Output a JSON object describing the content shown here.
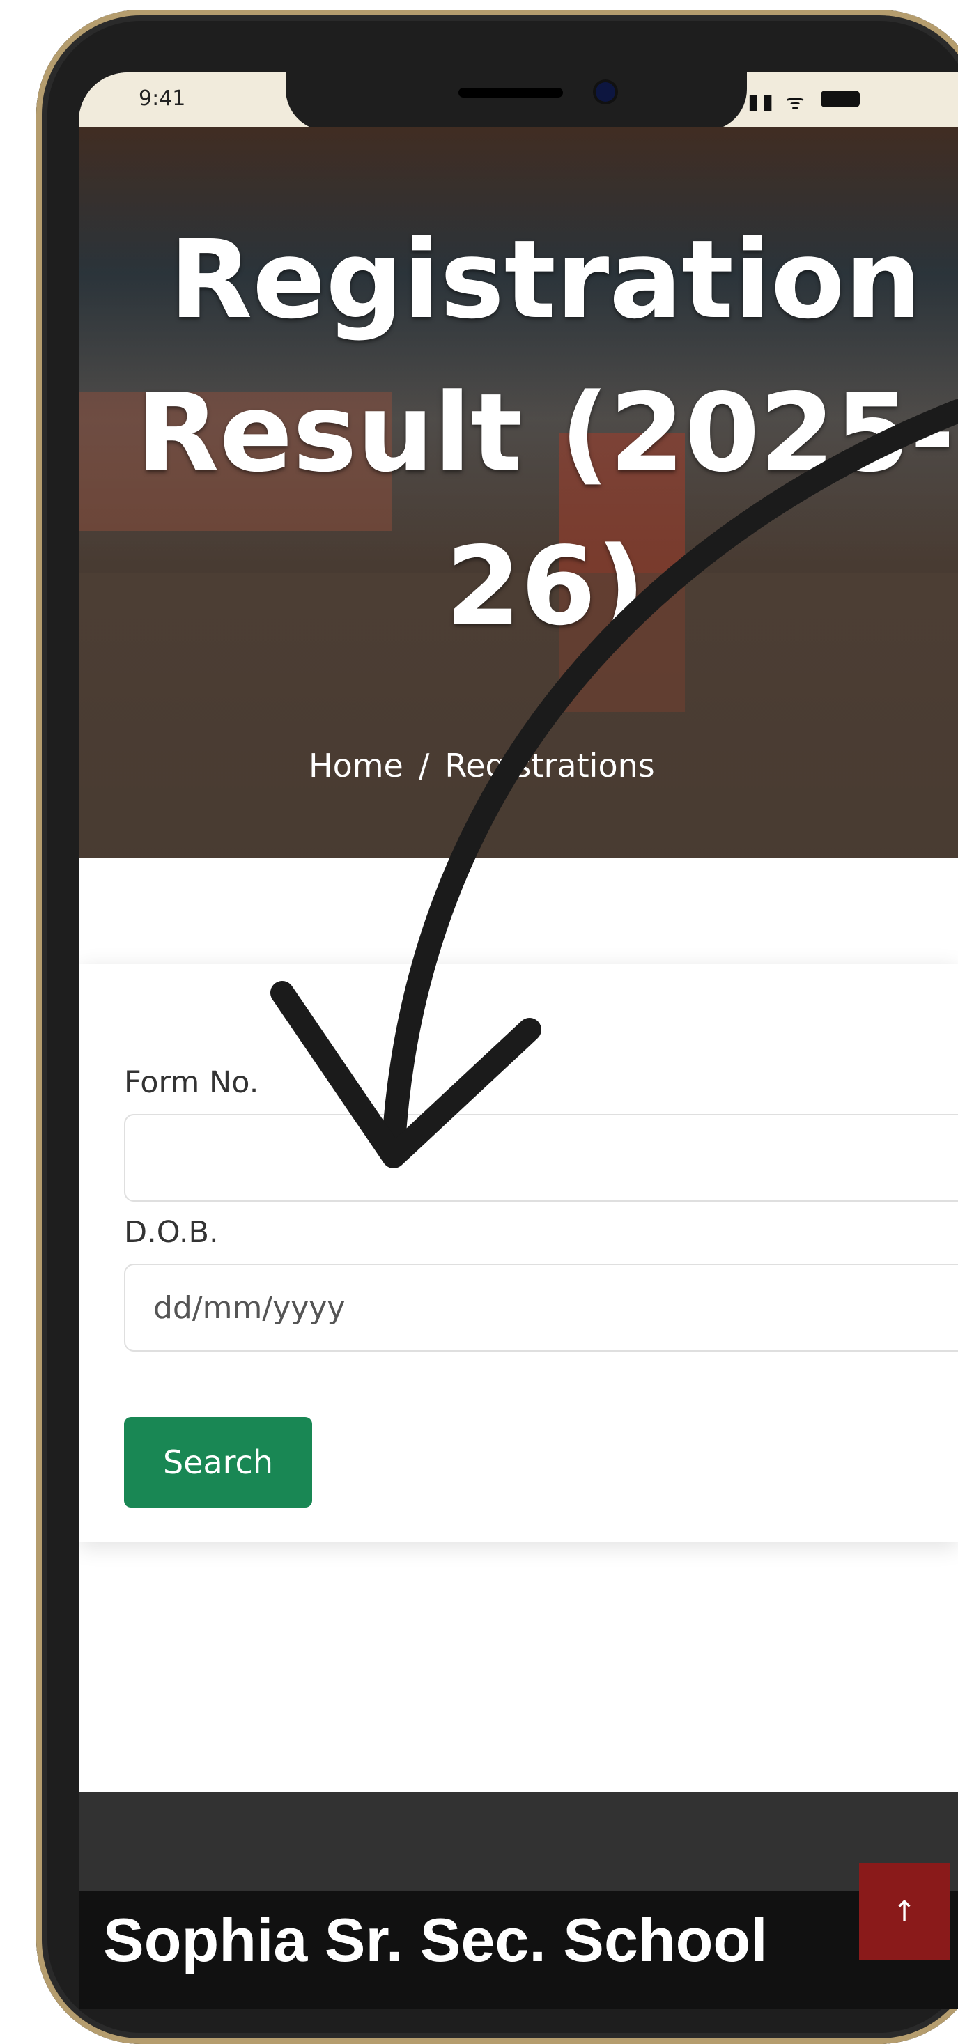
{
  "status_bar": {
    "time": "9:41"
  },
  "hero": {
    "title": "Registration Result (2025-26)",
    "breadcrumb": [
      "Home",
      "Registrations"
    ],
    "breadcrumb_separator": "/"
  },
  "form": {
    "form_no_label": "Form No.",
    "form_no_value": "",
    "dob_label": "D.O.B.",
    "dob_placeholder": "dd/mm/yyyy",
    "search_button": "Search"
  },
  "footer": {
    "school_name": "Sophia Sr. Sec. School",
    "back_to_top_icon": "arrow-up-icon"
  },
  "colors": {
    "button": "#198754",
    "footer_dark": "#323232",
    "back_to_top": "#8a1a1a"
  }
}
